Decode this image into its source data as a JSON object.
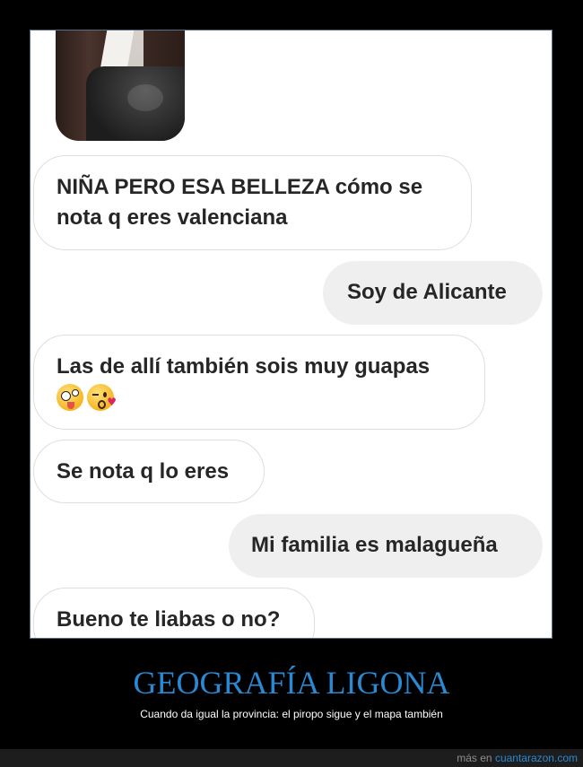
{
  "chat": {
    "messages": [
      {
        "side": "in",
        "lines": [
          "NIÑA PERO ESA BELLEZA cómo se",
          "nota q eres valenciana"
        ]
      },
      {
        "side": "out",
        "lines": [
          "Soy de Alicante"
        ]
      },
      {
        "side": "in",
        "lines": [
          "Las de allí también sois muy guapas"
        ],
        "emojis": [
          "zany-face-emoji",
          "face-blowing-kiss-emoji"
        ]
      },
      {
        "side": "in",
        "lines": [
          "Se nota q lo eres"
        ]
      },
      {
        "side": "out",
        "lines": [
          "Mi familia es malagueña"
        ]
      },
      {
        "side": "in",
        "lines": [
          "Bueno te liabas o no?"
        ]
      }
    ]
  },
  "caption": {
    "title": "GEOGRAFÍA LIGONA",
    "subtitle": "Cuando da igual la provincia: el piropo sigue y el mapa también"
  },
  "footer": {
    "prefix": "más en",
    "site": "cuantarazon.com"
  },
  "colors": {
    "background": "#000000",
    "accent": "#2a89d3",
    "bubble_out": "#efefef",
    "bubble_in_border": "#dedede"
  }
}
